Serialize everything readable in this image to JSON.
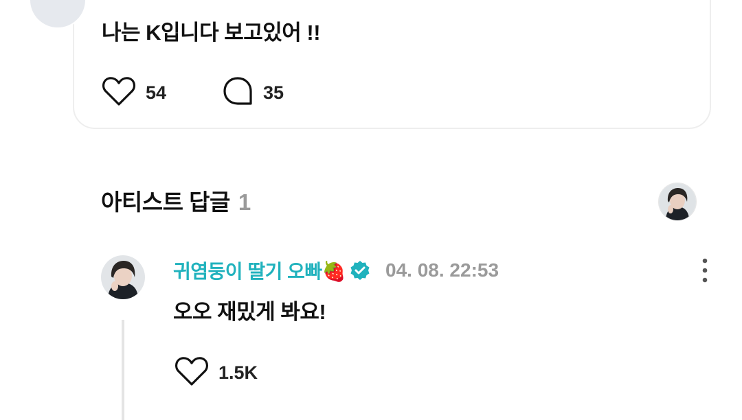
{
  "post": {
    "text": "나는 K입니다 보고있어 !!",
    "likes": "54",
    "comments": "35"
  },
  "artist_replies": {
    "title": "아티스트 답글",
    "count": "1"
  },
  "comment": {
    "author": "귀염둥이 딸기 오빠🍓",
    "timestamp": "04. 08. 22:53",
    "text": "오오 재밌게 봐요!",
    "likes": "1.5K"
  },
  "icons": {
    "like": "heart-icon",
    "comment": "comment-bubble-icon",
    "verified": "verified-badge-icon",
    "more": "more-vertical-icon"
  },
  "colors": {
    "accent": "#20b2bd",
    "muted": "#9a9a9a",
    "text": "#111111"
  }
}
